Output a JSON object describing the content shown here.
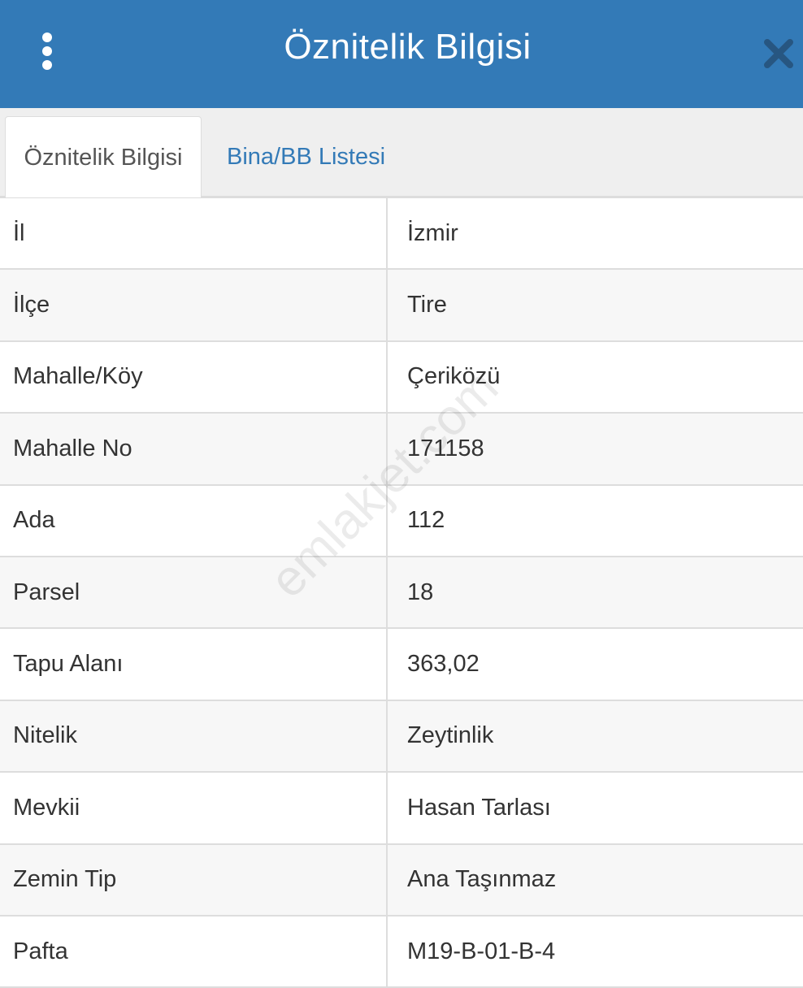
{
  "header": {
    "title": "Öznitelik Bilgisi",
    "accent_color": "#337ab7",
    "menu_icon": "more-vertical-icon",
    "close_icon": "close-icon"
  },
  "tabs": [
    {
      "label": "Öznitelik Bilgisi",
      "active": true
    },
    {
      "label": "Bina/BB Listesi",
      "active": false
    }
  ],
  "rows": [
    {
      "key": "İl",
      "value": "İzmir"
    },
    {
      "key": "İlçe",
      "value": "Tire"
    },
    {
      "key": "Mahalle/Köy",
      "value": "Çeriközü"
    },
    {
      "key": "Mahalle No",
      "value": "171158"
    },
    {
      "key": "Ada",
      "value": "112"
    },
    {
      "key": "Parsel",
      "value": "18"
    },
    {
      "key": "Tapu Alanı",
      "value": "363,02"
    },
    {
      "key": "Nitelik",
      "value": "Zeytinlik"
    },
    {
      "key": "Mevkii",
      "value": "Hasan Tarlası"
    },
    {
      "key": "Zemin Tip",
      "value": "Ana Taşınmaz"
    },
    {
      "key": "Pafta",
      "value": "M19-B-01-B-4"
    }
  ],
  "watermark": "emlakjet.com"
}
